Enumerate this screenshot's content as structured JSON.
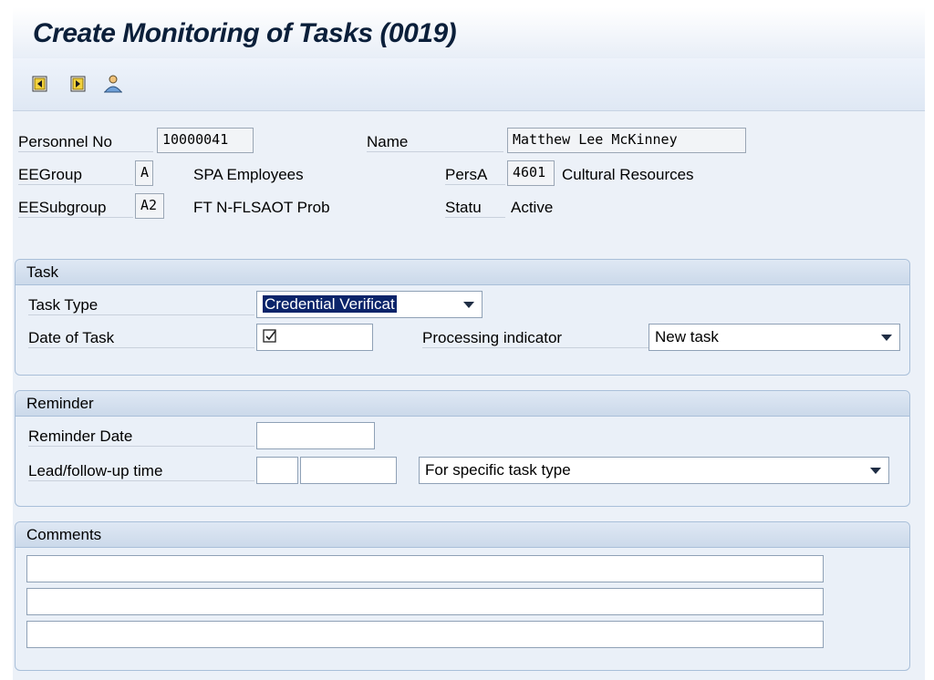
{
  "header": {
    "title": "Create Monitoring of Tasks (0019)"
  },
  "toolbar": {
    "icons": [
      "previous-record-icon",
      "next-record-icon",
      "person-icon"
    ]
  },
  "employee": {
    "personnel_no_label": "Personnel No",
    "personnel_no_value": "10000041",
    "name_label": "Name",
    "name_value": "Matthew Lee McKinney",
    "eegroup_label": "EEGroup",
    "eegroup_value": "A",
    "eegroup_text": "SPA Employees",
    "persa_label": "PersA",
    "persa_value": "4601",
    "persa_text": "Cultural Resources",
    "eesubgroup_label": "EESubgroup",
    "eesubgroup_value": "A2",
    "eesubgroup_text": "FT N-FLSAOT Prob",
    "status_label": "Statu",
    "status_text": "Active"
  },
  "task": {
    "title": "Task",
    "task_type_label": "Task Type",
    "task_type_value": "Credential Verificat",
    "date_label": "Date of Task",
    "date_value": "",
    "processing_label": "Processing indicator",
    "processing_value": "New task"
  },
  "reminder": {
    "title": "Reminder",
    "date_label": "Reminder Date",
    "date_value": "",
    "lead_label": "Lead/follow-up time",
    "lead_value": "",
    "lead_unit_value": "",
    "lead_select_value": "For specific task type"
  },
  "comments": {
    "title": "Comments",
    "lines": [
      "",
      "",
      ""
    ]
  },
  "colors": {
    "title_text": "#0b1f3a",
    "selection": "#0a246a",
    "group_border": "#a9bfd9"
  }
}
